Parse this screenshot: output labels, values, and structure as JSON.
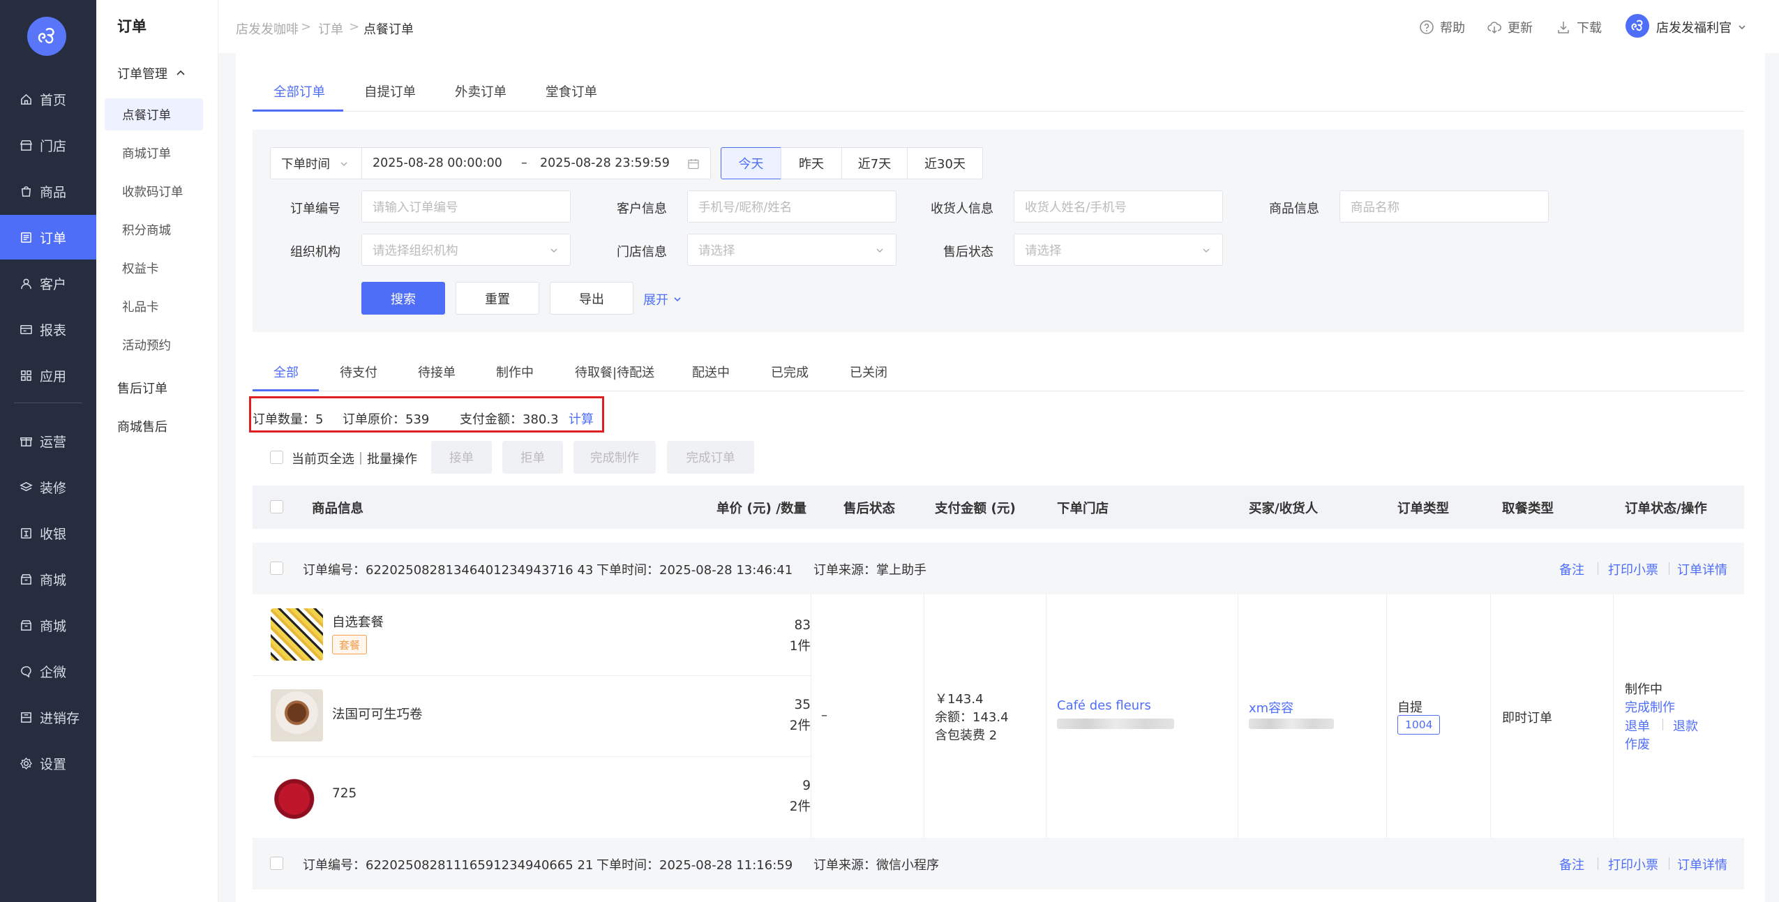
{
  "nav": {
    "items": [
      {
        "label": "首页",
        "icon": "home-icon"
      },
      {
        "label": "门店",
        "icon": "store-icon"
      },
      {
        "label": "商品",
        "icon": "bag-icon"
      },
      {
        "label": "订单",
        "icon": "order-icon",
        "active": true
      },
      {
        "label": "客户",
        "icon": "user-icon"
      },
      {
        "label": "报表",
        "icon": "report-icon"
      },
      {
        "label": "应用",
        "icon": "apps-icon"
      },
      {
        "label": "运营",
        "icon": "gift-icon"
      },
      {
        "label": "装修",
        "icon": "layers-icon"
      },
      {
        "label": "收银",
        "icon": "cashier-icon"
      },
      {
        "label": "商城",
        "icon": "mall-icon"
      },
      {
        "label": "商城",
        "icon": "mall-icon"
      },
      {
        "label": "企微",
        "icon": "chat-icon"
      },
      {
        "label": "进销存",
        "icon": "inventory-icon"
      },
      {
        "label": "设置",
        "icon": "settings-icon"
      }
    ]
  },
  "sub": {
    "title": "订单",
    "group": "订单管理",
    "items": [
      "点餐订单",
      "商城订单",
      "收款码订单",
      "积分商城",
      "权益卡",
      "礼品卡",
      "活动预约"
    ],
    "after_sale": "售后订单",
    "mall_after_sale": "商城售后"
  },
  "breadcrumb": [
    "店发发咖啡",
    "订单",
    "点餐订单"
  ],
  "top": {
    "help": "帮助",
    "update": "更新",
    "download": "下载",
    "user": "店发发福利官"
  },
  "tabs": [
    "全部订单",
    "自提订单",
    "外卖订单",
    "堂食订单"
  ],
  "filter": {
    "time_type": "下单时间",
    "start": "2025-08-28 00:00:00",
    "sep": "–",
    "end": "2025-08-28 23:59:59",
    "quick": [
      "今天",
      "昨天",
      "近7天",
      "近30天"
    ],
    "order_no_label": "订单编号",
    "order_no_ph": "请输入订单编号",
    "customer_label": "客户信息",
    "customer_ph": "手机号/昵称/姓名",
    "receiver_label": "收货人信息",
    "receiver_ph": "收货人姓名/手机号",
    "goods_label": "商品信息",
    "goods_ph": "商品名称",
    "org_label": "组织机构",
    "org_ph": "请选择组织机构",
    "store_label": "门店信息",
    "store_ph": "请选择",
    "after_label": "售后状态",
    "after_ph": "请选择",
    "search": "搜索",
    "reset": "重置",
    "export": "导出",
    "expand": "展开"
  },
  "status_tabs": [
    "全部",
    "待支付",
    "待接单",
    "制作中",
    "待取餐|待配送",
    "配送中",
    "已完成",
    "已关闭"
  ],
  "stats": {
    "count": "订单数量：5",
    "original": "订单原价：539",
    "paid": "支付金额：380.3",
    "calc": "计算"
  },
  "batch": {
    "select_all": "当前页全选｜批量操作",
    "accept": "接单",
    "reject": "拒单",
    "finish_make": "完成制作",
    "finish_order": "完成订单"
  },
  "columns": [
    "商品信息",
    "单价 (元) /数量",
    "售后状态",
    "支付金额 (元)",
    "下单门店",
    "买家/收货人",
    "订单类型",
    "取餐类型",
    "订单状态/操作"
  ],
  "orders": [
    {
      "no": "订单编号：62202508281346401234943716 43",
      "time": "下单时间：2025-08-28 13:46:41",
      "source": "订单来源：掌上助手",
      "actions": [
        "备注",
        "打印小票",
        "订单详情"
      ],
      "items": [
        {
          "name": "自选套餐",
          "tag": "套餐",
          "price": "83",
          "qty": "1件"
        },
        {
          "name": "法国可可生巧卷",
          "price": "35",
          "qty": "2件"
        },
        {
          "name": "725",
          "price": "9",
          "qty": "2件"
        }
      ],
      "after_sale": "–",
      "pay": [
        "￥143.4",
        "余额：143.4",
        "含包装费 2"
      ],
      "store": "Café des fleurs",
      "buyer": "xm容容",
      "order_type": "自提",
      "pickup_no": "1004",
      "take_type": "即时订单",
      "status": "制作中",
      "ops": {
        "finish": "完成制作",
        "refund_order": "退单",
        "refund": "退款",
        "void": "作废"
      }
    },
    {
      "no": "订单编号：62202508281116591234940665 21",
      "time": "下单时间：2025-08-28 11:16:59",
      "source": "订单来源：微信小程序",
      "actions": [
        "备注",
        "打印小票",
        "订单详情"
      ]
    }
  ]
}
